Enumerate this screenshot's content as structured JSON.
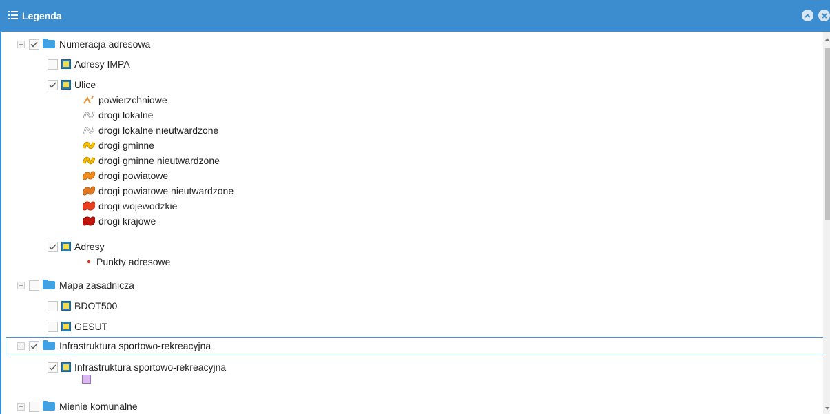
{
  "header": {
    "title": "Legenda",
    "icon": "list-icon",
    "buttons": [
      "collapse-up-icon",
      "close-icon"
    ]
  },
  "tree": {
    "g1": {
      "label": "Numeracja adresowa",
      "checked": true
    },
    "adresy_impa": {
      "label": "Adresy IMPA",
      "checked": false
    },
    "ulice": {
      "label": "Ulice",
      "checked": true
    },
    "ulice_legend": [
      {
        "label": "powierzchniowe",
        "color": "#e8902a"
      },
      {
        "label": "drogi lokalne",
        "color": "#9a9a9a"
      },
      {
        "label": "drogi lokalne nieutwardzone",
        "color": "#9a9a9a"
      },
      {
        "label": "drogi gminne",
        "color": "#f0b400"
      },
      {
        "label": "drogi gminne nieutwardzone",
        "color": "#e6a600"
      },
      {
        "label": "drogi powiatowe",
        "color": "#e8851a"
      },
      {
        "label": "drogi powiatowe nieutwardzone",
        "color": "#d9731f"
      },
      {
        "label": "drogi wojewodzkie",
        "color": "#e03b1e"
      },
      {
        "label": "drogi krajowe",
        "color": "#b3140d"
      }
    ],
    "adresy": {
      "label": "Adresy",
      "checked": true
    },
    "adresy_legend": {
      "label": "Punkty adresowe",
      "color": "#e0322b"
    },
    "g2": {
      "label": "Mapa zasadnicza",
      "checked": false
    },
    "bdot500": {
      "label": "BDOT500",
      "checked": false
    },
    "gesut": {
      "label": "GESUT",
      "checked": false
    },
    "g3": {
      "label": "Infrastruktura sportowo-rekreacyjna",
      "checked": true
    },
    "infra_layer": {
      "label": "Infrastruktura sportowo-rekreacyjna",
      "checked": true
    },
    "infra_symbol_color": "#d9b8f2",
    "g4": {
      "label": "Mienie komunalne",
      "checked": false
    }
  }
}
